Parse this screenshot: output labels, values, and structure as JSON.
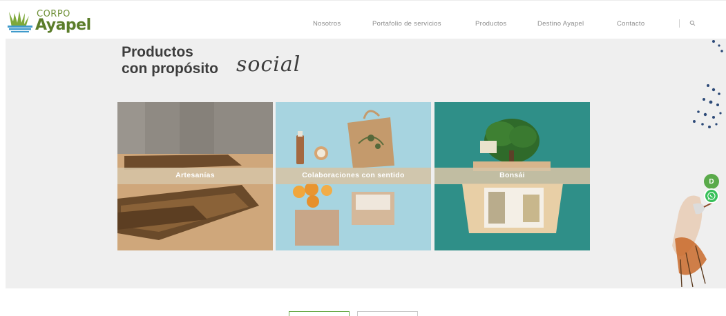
{
  "brand": {
    "corpo": "CORPO",
    "ayapel": "Ayapel",
    "primary_color": "#5b7d2a",
    "accent_color": "#6d8f35"
  },
  "nav": {
    "items": [
      {
        "label": "Nosotros"
      },
      {
        "label": "Portafolio de servicios"
      },
      {
        "label": "Productos"
      },
      {
        "label": "Destino Ayapel"
      },
      {
        "label": "Contacto"
      }
    ],
    "search_icon": "search-icon"
  },
  "hero": {
    "title_line1": "Productos",
    "title_line2": "con propósito",
    "title_script": "social",
    "background": "#efefef"
  },
  "cards": [
    {
      "label": "Artesanías"
    },
    {
      "label": "Colaboraciones con sentido"
    },
    {
      "label": "Bonsái"
    }
  ],
  "floating": {
    "badge_letter": "D",
    "whatsapp_icon": "whatsapp-icon"
  },
  "pager": {
    "prev_label": "",
    "next_label": ""
  }
}
